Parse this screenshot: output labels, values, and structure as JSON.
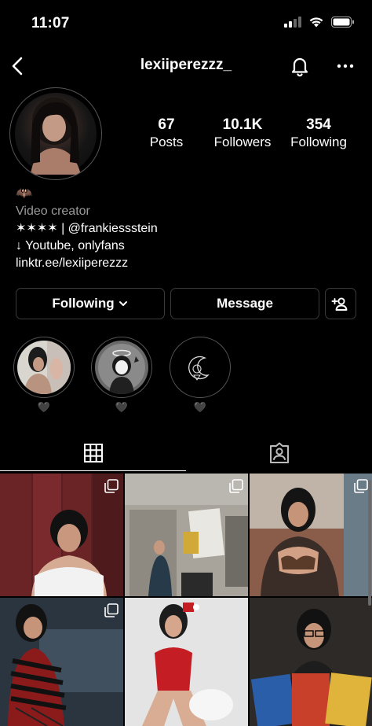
{
  "status": {
    "time": "11:07"
  },
  "header": {
    "username": "lexiiperezzz_",
    "icons": [
      "chevron-left-icon",
      "bell-icon",
      "ellipsis-icon"
    ]
  },
  "stats": [
    {
      "value": "67",
      "label": "Posts"
    },
    {
      "value": "10.1K",
      "label": "Followers"
    },
    {
      "value": "354",
      "label": "Following"
    }
  ],
  "bio": {
    "emoji": "🦇",
    "category": "Video creator",
    "lines": [
      "✶✶✶✶ | @frankiessstein",
      "↓ Youtube, onlyfans",
      "linktr.ee/lexiiperezzz"
    ]
  },
  "actions": {
    "following_label": "Following",
    "message_label": "Message"
  },
  "highlights": [
    {
      "label": "🖤"
    },
    {
      "label": "🖤"
    },
    {
      "label": "🖤"
    }
  ],
  "tabs": [
    "grid-icon",
    "tagged-icon"
  ],
  "colors": {
    "background": "#000000",
    "border": "#3a3a3a",
    "muted": "#9a9a9a"
  }
}
